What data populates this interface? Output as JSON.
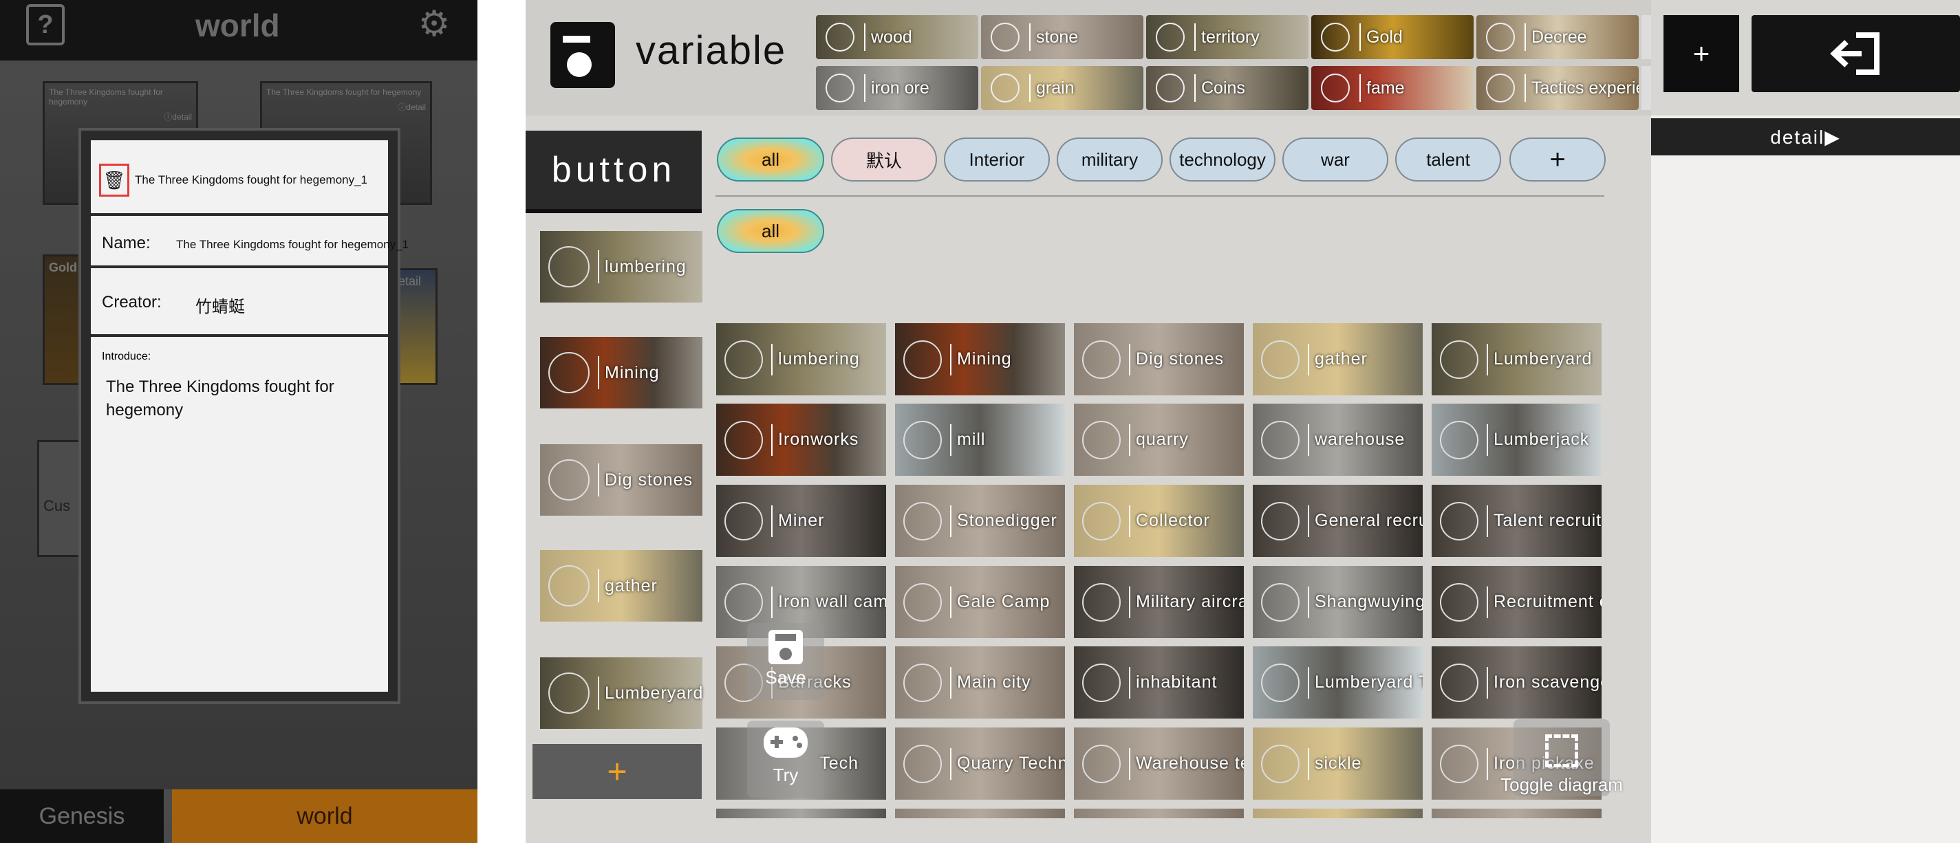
{
  "left_panel": {
    "header": {
      "title": "world",
      "help_icon": "help-book-icon",
      "settings_icon": "gear-icon"
    },
    "background_cards": [
      {
        "title": "The Three Kingdoms fought for hegemony",
        "detail": "ⓘdetail"
      },
      {
        "title": "The Three Kingdoms fought for hegemony",
        "detail": "ⓘdetail"
      },
      {
        "title": "Gold",
        "detail": ""
      },
      {
        "title": "",
        "detail": "detail"
      },
      {
        "title": "Cus",
        "detail": ""
      }
    ],
    "modal": {
      "delete_icon": "trash-icon",
      "file_name": "The Three Kingdoms fought for hegemony_1",
      "name_label": "Name:",
      "name_value": "The Three Kingdoms fought for hegemony_1",
      "creator_label": "Creator:",
      "creator_value": "竹蜻蜓",
      "introduce_label": "Introduce:",
      "introduce_value": "The Three Kingdoms fought for hegemony"
    },
    "bottom_tabs": {
      "genesis": "Genesis",
      "world": "world"
    }
  },
  "editor": {
    "logo_icon": "variable-box-icon",
    "title": "variable",
    "resources": [
      {
        "label": "wood",
        "bg": "forest"
      },
      {
        "label": "stone",
        "bg": "stone"
      },
      {
        "label": "territory",
        "bg": "forest"
      },
      {
        "label": "Gold",
        "bg": "gold"
      },
      {
        "label": "Decree",
        "bg": "paper"
      },
      {
        "label": "iron ore",
        "bg": "gray"
      },
      {
        "label": "grain",
        "bg": "field"
      },
      {
        "label": "Coins",
        "bg": "coin"
      },
      {
        "label": "fame",
        "bg": "red"
      },
      {
        "label": "Tactics experienc",
        "bg": "paper"
      }
    ],
    "add_variable": "+",
    "exit_icon": "exit-icon",
    "section_title": "button",
    "filter_tabs": [
      "all",
      "默认",
      "Interior",
      "military",
      "technology",
      "war",
      "talent",
      "+"
    ],
    "sub_filter": "all",
    "sidebar_items": [
      "lumbering",
      "Mining",
      "Dig stones",
      "gather",
      "Lumberyard"
    ],
    "sidebar_add": "+",
    "grid": [
      [
        "lumbering",
        "Mining",
        "Dig stones",
        "gather",
        "Lumberyard"
      ],
      [
        "Ironworks",
        "mill",
        "quarry",
        "warehouse",
        "Lumberjack"
      ],
      [
        "Miner",
        "Stonedigger",
        "Collector",
        "General recruitm",
        "Talent recruitme"
      ],
      [
        "Iron wall camp",
        "Gale Camp",
        "Military aircraft",
        "Shangwuying",
        "Recruitment offi"
      ],
      [
        "Barracks",
        "Main city",
        "inhabitant",
        "Lumberyard Tech",
        "Iron scavenger t"
      ],
      [
        "Tech",
        "Quarry Technolo",
        "Warehouse techn",
        "sickle",
        "Iron pickaxe"
      ]
    ],
    "save_label": "Save",
    "try_label": "Try",
    "toggle_label": "Toggle diagram",
    "detail_label": "detail▶"
  }
}
